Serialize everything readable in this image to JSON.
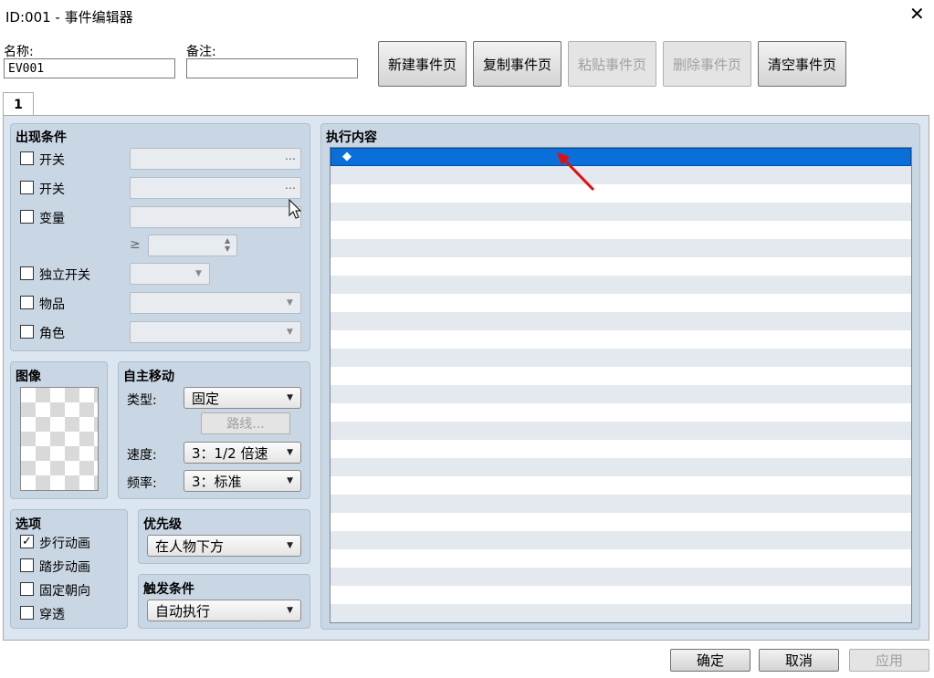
{
  "window": {
    "title": "ID:001 - 事件编辑器",
    "close_label": "✕"
  },
  "header": {
    "name_label": "名称:",
    "name_value": "EV001",
    "note_label": "备注:",
    "note_value": "",
    "buttons": {
      "new_page": "新建事件页",
      "copy_page": "复制事件页",
      "paste_page": "粘贴事件页",
      "delete_page": "删除事件页",
      "clear_page": "清空事件页"
    }
  },
  "tabs": [
    {
      "label": "1",
      "selected": true
    }
  ],
  "conditions": {
    "title": "出现条件",
    "switch1_label": "开关",
    "switch2_label": "开关",
    "variable_label": "变量",
    "gte_symbol": "≥",
    "self_switch_label": "独立开关",
    "item_label": "物品",
    "actor_label": "角色",
    "ellipsis": "…"
  },
  "image": {
    "title": "图像"
  },
  "autonomous_movement": {
    "title": "自主移动",
    "type_label": "类型:",
    "type_value": "固定",
    "route_button": "路线...",
    "speed_label": "速度:",
    "speed_value": "3：1/2 倍速",
    "freq_label": "频率:",
    "freq_value": "3：标准"
  },
  "options": {
    "title": "选项",
    "walking": {
      "label": "步行动画",
      "checked": true
    },
    "stepping": {
      "label": "踏步动画",
      "checked": false
    },
    "direction_fix": {
      "label": "固定朝向",
      "checked": false
    },
    "through": {
      "label": "穿透",
      "checked": false
    }
  },
  "priority": {
    "title": "优先级",
    "value": "在人物下方"
  },
  "trigger": {
    "title": "触发条件",
    "value": "自动执行"
  },
  "contents": {
    "title": "执行内容",
    "first_row_marker": "◆",
    "selected_row": 0
  },
  "footer": {
    "ok": "确定",
    "cancel": "取消",
    "apply": "应用"
  },
  "colors": {
    "selection": "#0a6fd8",
    "panel": "#c9d6e3",
    "annotation_arrow": "#e01010"
  }
}
